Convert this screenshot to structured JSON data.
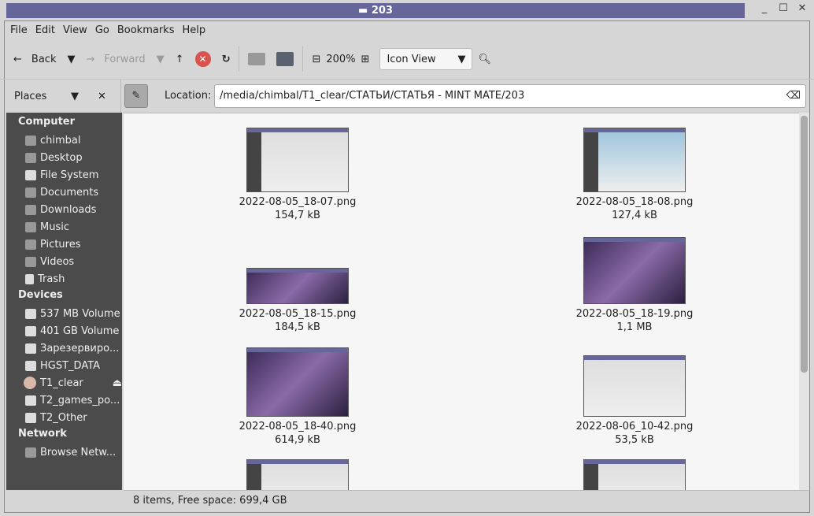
{
  "window": {
    "title": "203"
  },
  "menu": [
    "File",
    "Edit",
    "View",
    "Go",
    "Bookmarks",
    "Help"
  ],
  "toolbar": {
    "back": "Back",
    "forward": "Forward",
    "zoom": "200%",
    "view_mode": "Icon View"
  },
  "location": {
    "label": "Location:",
    "path": "/media/chimbal/T1_clear/СТАТЬИ/СТАТЬЯ - MINT MATE/203",
    "places_label": "Places"
  },
  "sidebar": {
    "computer_header": "Computer",
    "computer": [
      "chimbal",
      "Desktop",
      "File System",
      "Documents",
      "Downloads",
      "Music",
      "Pictures",
      "Videos",
      "Trash"
    ],
    "devices_header": "Devices",
    "devices": [
      "537 MB Volume",
      "401 GB Volume",
      "Зарезервиро...",
      "HGST_DATA",
      "T1_clear",
      "T2_games_po...",
      "T2_Other"
    ],
    "network_header": "Network",
    "network": [
      "Browse Netw..."
    ]
  },
  "files": [
    {
      "name": "2022-08-05_18-07.png",
      "size": "154,7 kB"
    },
    {
      "name": "2022-08-05_18-08.png",
      "size": "127,4 kB"
    },
    {
      "name": "2022-08-05_18-15.png",
      "size": "184,5 kB"
    },
    {
      "name": "2022-08-05_18-19.png",
      "size": "1,1 MB"
    },
    {
      "name": "2022-08-05_18-40.png",
      "size": "614,9 kB"
    },
    {
      "name": "2022-08-06_10-42.png",
      "size": "53,5 kB"
    }
  ],
  "status": "8 items, Free space: 699,4 GB"
}
